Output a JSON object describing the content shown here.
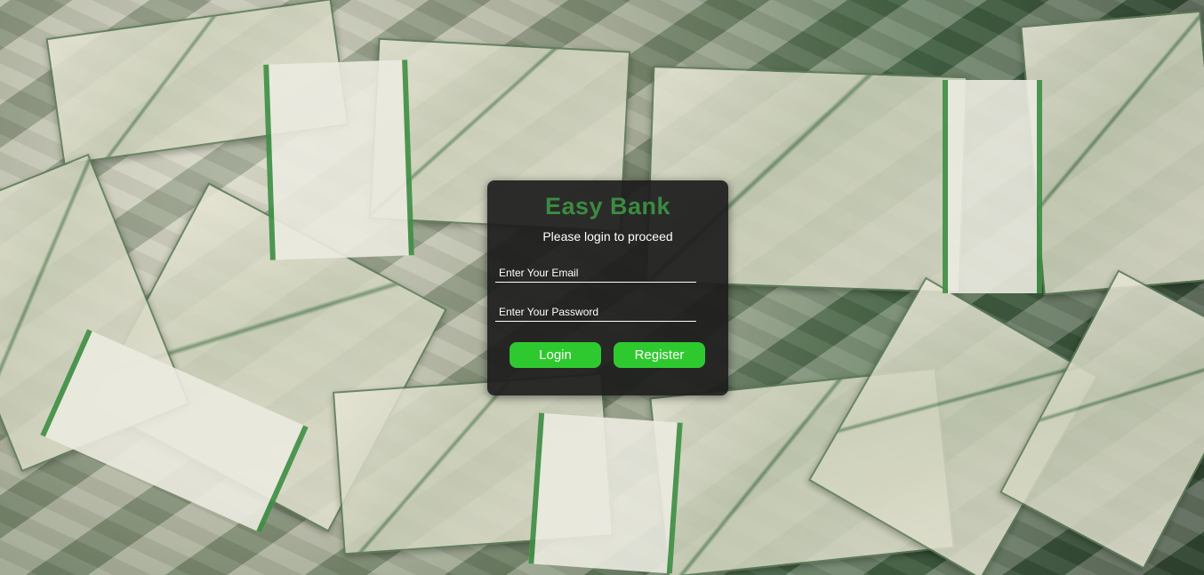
{
  "login": {
    "title": "Easy Bank",
    "subtitle": "Please login to proceed",
    "email_placeholder": "Enter Your Email",
    "password_placeholder": "Enter Your Password",
    "login_label": "Login",
    "register_label": "Register"
  },
  "colors": {
    "title": "#3c8a42",
    "button": "#2ec92e",
    "card_background": "#1c1c1c"
  }
}
